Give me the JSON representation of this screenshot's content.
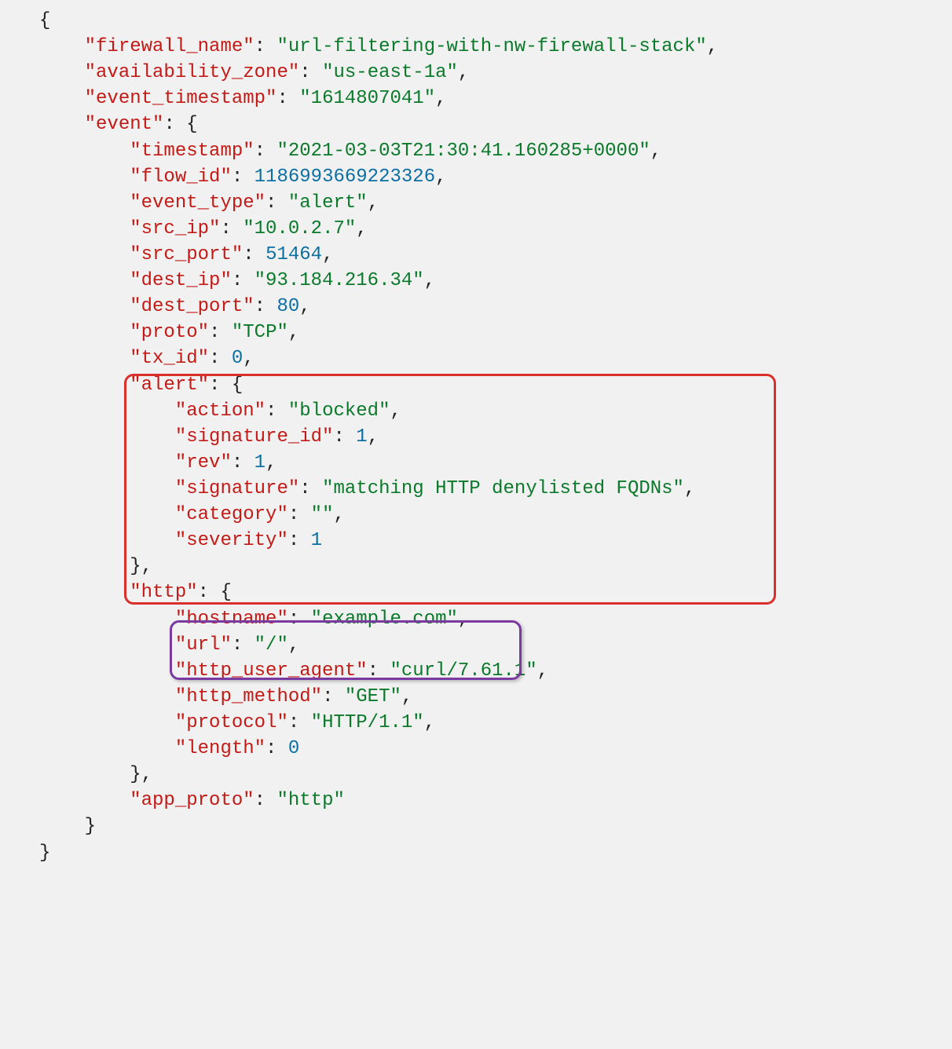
{
  "code": {
    "firewall_name_key": "\"firewall_name\"",
    "firewall_name_val": "\"url-filtering-with-nw-firewall-stack\"",
    "availability_zone_key": "\"availability_zone\"",
    "availability_zone_val": "\"us-east-1a\"",
    "event_timestamp_key": "\"event_timestamp\"",
    "event_timestamp_val": "\"1614807041\"",
    "event_key": "\"event\"",
    "timestamp_key": "\"timestamp\"",
    "timestamp_val": "\"2021-03-03T21:30:41.160285+0000\"",
    "flow_id_key": "\"flow_id\"",
    "flow_id_val": "1186993669223326",
    "event_type_key": "\"event_type\"",
    "event_type_val": "\"alert\"",
    "src_ip_key": "\"src_ip\"",
    "src_ip_val": "\"10.0.2.7\"",
    "src_port_key": "\"src_port\"",
    "src_port_val": "51464",
    "dest_ip_key": "\"dest_ip\"",
    "dest_ip_val": "\"93.184.216.34\"",
    "dest_port_key": "\"dest_port\"",
    "dest_port_val": "80",
    "proto_key": "\"proto\"",
    "proto_val": "\"TCP\"",
    "tx_id_key": "\"tx_id\"",
    "tx_id_val": "0",
    "alert_key": "\"alert\"",
    "action_key": "\"action\"",
    "action_val": "\"blocked\"",
    "signature_id_key": "\"signature_id\"",
    "signature_id_val": "1",
    "rev_key": "\"rev\"",
    "rev_val": "1",
    "signature_key": "\"signature\"",
    "signature_val": "\"matching HTTP denylisted FQDNs\"",
    "category_key": "\"category\"",
    "category_val": "\"\"",
    "severity_key": "\"severity\"",
    "severity_val": "1",
    "http_key": "\"http\"",
    "hostname_key": "\"hostname\"",
    "hostname_val": "\"example.com\"",
    "url_key": "\"url\"",
    "url_val": "\"/\"",
    "http_user_agent_key": "\"http_user_agent\"",
    "http_user_agent_val": "\"curl/7.61.1\"",
    "http_method_key": "\"http_method\"",
    "http_method_val": "\"GET\"",
    "protocol_key": "\"protocol\"",
    "protocol_val": "\"HTTP/1.1\"",
    "length_key": "\"length\"",
    "length_val": "0",
    "app_proto_key": "\"app_proto\"",
    "app_proto_val": "\"http\""
  },
  "highlights": {
    "red_box_desc": "alert object highlight",
    "purple_box_desc": "hostname and url highlight"
  },
  "colors": {
    "key": "#c41a16",
    "string": "#0a7a2a",
    "number": "#0b6fa4",
    "red_border": "#d9302c",
    "purple_border": "#7a3aa0",
    "background": "#f1f1f1"
  }
}
